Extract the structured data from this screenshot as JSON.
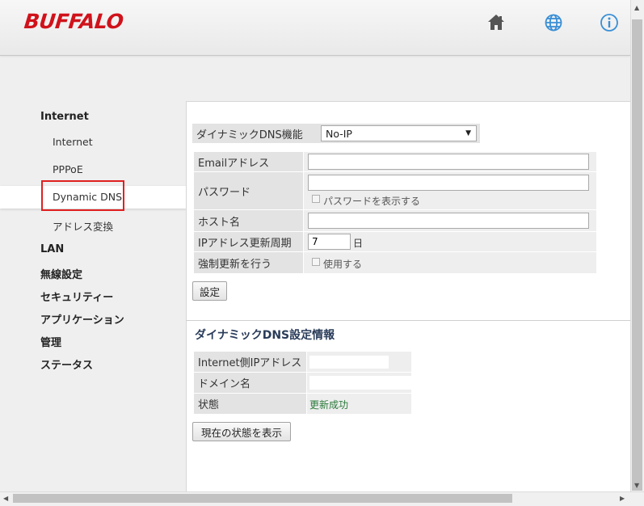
{
  "header": {
    "logo": "BUFFALO",
    "icons": [
      "home-icon",
      "globe-icon",
      "info-icon"
    ],
    "accent_color": "#d0121b",
    "icon_color": "#3a8fd6"
  },
  "sidebar": {
    "groups": [
      {
        "label": "Internet"
      },
      {
        "label": "LAN"
      },
      {
        "label": "無線設定"
      },
      {
        "label": "セキュリティー"
      },
      {
        "label": "アプリケーション"
      },
      {
        "label": "管理"
      },
      {
        "label": "ステータス"
      }
    ],
    "internet_items": [
      {
        "label": "Internet"
      },
      {
        "label": "PPPoE"
      },
      {
        "label": "Dynamic DNS",
        "active": true
      },
      {
        "label": "アドレス変換"
      }
    ]
  },
  "ddns_form": {
    "function_label": "ダイナミックDNS機能",
    "provider_selected": "No-IP",
    "email_label": "Emailアドレス",
    "email_value": "",
    "password_label": "パスワード",
    "password_value": "",
    "show_password_label": "パスワードを表示する",
    "show_password_checked": false,
    "host_label": "ホスト名",
    "host_value": "",
    "interval_label": "IPアドレス更新周期",
    "interval_value": "7",
    "interval_unit": "日",
    "force_label": "強制更新を行う",
    "force_use_label": "使用する",
    "force_checked": false,
    "submit_label": "設定"
  },
  "ddns_info": {
    "title": "ダイナミックDNS設定情報",
    "rows": [
      {
        "label": "Internet側IPアドレス",
        "value": ""
      },
      {
        "label": "ドメイン名",
        "value": ""
      },
      {
        "label": "状態",
        "value": "更新成功"
      }
    ],
    "show_status_label": "現在の状態を表示"
  }
}
